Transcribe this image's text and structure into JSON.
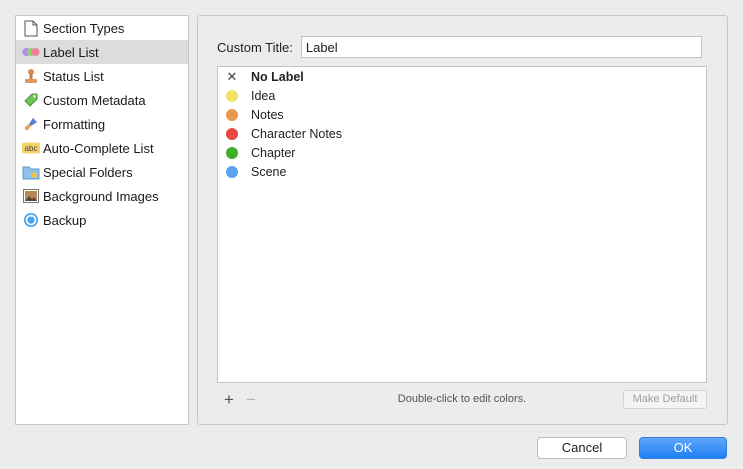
{
  "sidebar": {
    "items": [
      {
        "label": "Section Types",
        "icon": "document-icon",
        "selected": false
      },
      {
        "label": "Label List",
        "icon": "colored-circles-icon",
        "selected": true
      },
      {
        "label": "Status List",
        "icon": "stamp-icon",
        "selected": false
      },
      {
        "label": "Custom Metadata",
        "icon": "tag-icon",
        "selected": false
      },
      {
        "label": "Formatting",
        "icon": "paintbrush-icon",
        "selected": false
      },
      {
        "label": "Auto-Complete List",
        "icon": "abc-icon",
        "selected": false
      },
      {
        "label": "Special Folders",
        "icon": "folder-star-icon",
        "selected": false
      },
      {
        "label": "Background Images",
        "icon": "image-icon",
        "selected": false
      },
      {
        "label": "Backup",
        "icon": "backup-icon",
        "selected": false
      }
    ]
  },
  "main": {
    "title_label": "Custom Title:",
    "title_value": "Label",
    "labels": [
      {
        "name": "No Label",
        "color": null
      },
      {
        "name": "Idea",
        "color": "#f5e06a"
      },
      {
        "name": "Notes",
        "color": "#e89a4c"
      },
      {
        "name": "Character Notes",
        "color": "#e8473f"
      },
      {
        "name": "Chapter",
        "color": "#3fae2a"
      },
      {
        "name": "Scene",
        "color": "#5aa3f0"
      }
    ],
    "add_label": "+",
    "remove_label": "−",
    "hint": "Double-click to edit colors.",
    "make_default": "Make Default"
  },
  "buttons": {
    "cancel": "Cancel",
    "ok": "OK"
  }
}
